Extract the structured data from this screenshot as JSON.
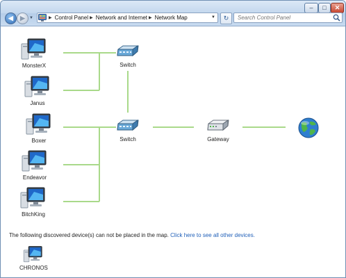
{
  "window": {
    "minimize_symbol": "–",
    "maximize_symbol": "□",
    "close_symbol": "✕"
  },
  "nav": {
    "back_symbol": "◀",
    "forward_symbol": "▶",
    "history_symbol": "▼"
  },
  "address": {
    "breadcrumbs": [
      "Control Panel",
      "Network and Internet",
      "Network Map"
    ],
    "separator": "▶",
    "dropdown_symbol": "▼"
  },
  "refresh_symbol": "↻",
  "search": {
    "placeholder": "Search Control Panel"
  },
  "colors": {
    "link_line": "#a9d98a",
    "link_text": "#1f5fb8",
    "titlebar": "#c4d8ee"
  },
  "map": {
    "computers": [
      {
        "label": "MonsterX",
        "icon": "computer-icon"
      },
      {
        "label": "Janus",
        "icon": "computer-icon"
      },
      {
        "label": "Boxer",
        "icon": "computer-icon"
      },
      {
        "label": "Endeavor",
        "icon": "computer-icon"
      },
      {
        "label": "BitchKing",
        "icon": "computer-icon"
      }
    ],
    "switches": [
      {
        "label": "Switch",
        "icon": "switch-icon"
      },
      {
        "label": "Switch",
        "icon": "switch-icon"
      }
    ],
    "gateway": {
      "label": "Gateway",
      "icon": "gateway-icon"
    },
    "internet": {
      "icon": "internet-globe-icon"
    }
  },
  "notice": {
    "text": "The following discovered device(s) can not be placed in the map.",
    "link": "Click here to see all other devices."
  },
  "unplaced": [
    {
      "label": "CHRONOS",
      "icon": "computer-icon"
    }
  ]
}
